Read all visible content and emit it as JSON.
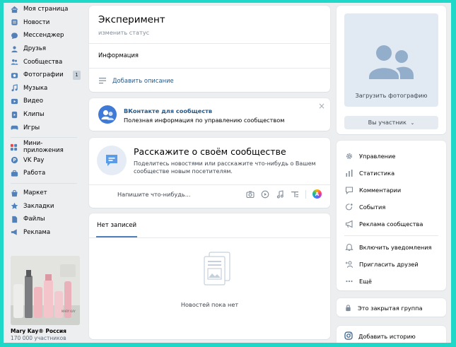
{
  "nav": {
    "items": [
      {
        "label": "Моя страница",
        "icon": "home-icon"
      },
      {
        "label": "Новости",
        "icon": "news-icon"
      },
      {
        "label": "Мессенджер",
        "icon": "messenger-icon"
      },
      {
        "label": "Друзья",
        "icon": "friends-icon"
      },
      {
        "label": "Сообщества",
        "icon": "communities-icon"
      },
      {
        "label": "Фотографии",
        "icon": "photo-icon",
        "badge": "1"
      },
      {
        "label": "Музыка",
        "icon": "music-icon"
      },
      {
        "label": "Видео",
        "icon": "video-icon"
      },
      {
        "label": "Клипы",
        "icon": "clips-icon"
      },
      {
        "label": "Игры",
        "icon": "games-icon"
      }
    ],
    "items2": [
      {
        "label": "Мини-приложения",
        "icon": "mini-apps-icon"
      },
      {
        "label": "VK Pay",
        "icon": "vkpay-icon"
      },
      {
        "label": "Работа",
        "icon": "work-icon"
      }
    ],
    "items3": [
      {
        "label": "Маркет",
        "icon": "market-icon"
      },
      {
        "label": "Закладки",
        "icon": "bookmark-icon"
      },
      {
        "label": "Файлы",
        "icon": "files-icon"
      },
      {
        "label": "Реклама",
        "icon": "ads-icon"
      }
    ]
  },
  "ad": {
    "title": "Mary Kay® Россия",
    "subtitle": "170 000 участников",
    "brand_text": "MARY KAY"
  },
  "header": {
    "title": "Эксперимент",
    "status": "изменить статус",
    "info": "Информация",
    "add_description": "Добавить описание"
  },
  "promo": {
    "title": "ВКонтакте для сообществ",
    "text": "Полезная информация по управлению сообществом",
    "close": "×"
  },
  "post": {
    "heading": "Расскажите о своём сообществе",
    "text": "Поделитесь новостями или расскажите что-нибудь о Вашем сообществе новым посетителям.",
    "placeholder": "Напишите что-нибудь...",
    "avatar_letter": "A"
  },
  "wall": {
    "tab": "Нет записей",
    "empty": "Новостей пока нет"
  },
  "photo": {
    "upload": "Загрузить фотографию",
    "member_button": "Вы участник"
  },
  "menu": {
    "items": [
      {
        "label": "Управление",
        "icon": "gear-icon"
      },
      {
        "label": "Статистика",
        "icon": "stats-icon"
      },
      {
        "label": "Комментарии",
        "icon": "comments-icon"
      },
      {
        "label": "События",
        "icon": "events-icon"
      },
      {
        "label": "Реклама сообщества",
        "icon": "megaphone-icon"
      }
    ],
    "items2": [
      {
        "label": "Включить уведомления",
        "icon": "bell-icon"
      },
      {
        "label": "Пригласить друзей",
        "icon": "invite-icon"
      },
      {
        "label": "Ещё",
        "icon": "more-icon"
      }
    ]
  },
  "closed_group": "Это закрытая группа",
  "story": "Добавить историю",
  "colors": {
    "accent": "#5181b8",
    "link": "#2a5885",
    "background": "#edeef0",
    "frame": "#1fd8c8"
  }
}
